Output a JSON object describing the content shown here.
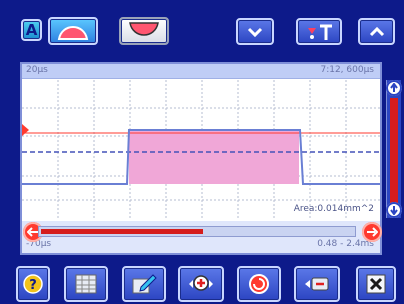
{
  "toolbar": {
    "mode_a_label": "A",
    "icons": [
      "rising-edge-icon",
      "falling-edge-icon",
      "chevron-down-icon",
      "probe-settings-icon",
      "chevron-up-icon"
    ]
  },
  "scope": {
    "time_per_div": "20µs",
    "cursor_time": "7:12, 600µs",
    "start_time": "-70µs",
    "range": "0.48 - 2.4ms",
    "area_readout": "Area:0.014mm^2",
    "pulse_color": "#f0a7d7",
    "trace_color": "#6a7fd4",
    "marker_color": "#ff3a2f",
    "scroll_progress": 0.52
  },
  "bottom_bar": {
    "icons": [
      "help-icon",
      "table-icon",
      "edit-icon",
      "zoom-in-icon",
      "record-icon",
      "camera-icon",
      "close-icon"
    ]
  }
}
